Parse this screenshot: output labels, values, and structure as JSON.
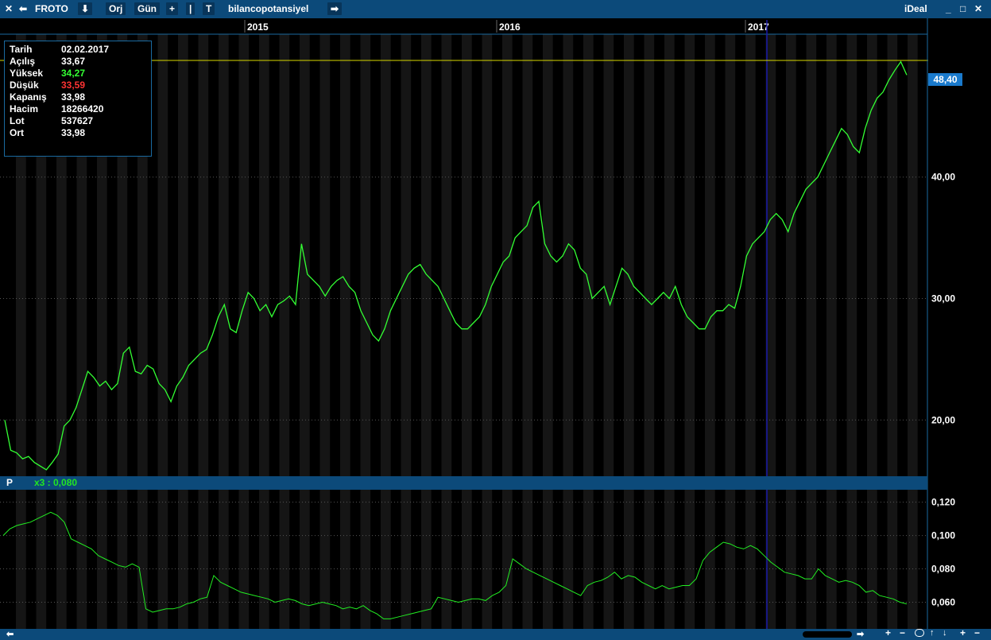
{
  "toolbar": {
    "close_glyph": "✕",
    "back_glyph": "⬅",
    "symbol": "FROTO",
    "down_glyph": "⬇",
    "orj_label": "Orj",
    "period_label": "Gün",
    "plus_label": "+",
    "bar_label": "|",
    "text_label": "T",
    "indicator_name": "bilancopotansiyel",
    "next_glyph": "➡",
    "brand": "iDeal",
    "minimize_glyph": "_",
    "maximize_glyph": "□",
    "close2_glyph": "✕"
  },
  "info": {
    "date_label": "Tarih",
    "date": "02.02.2017",
    "open_label": "Açılış",
    "open": "33,67",
    "high_label": "Yüksek",
    "high": "34,27",
    "low_label": "Düşük",
    "low": "33,59",
    "close_label": "Kapanış",
    "close": "33,98",
    "volume_label": "Hacim",
    "volume": "18266420",
    "lot_label": "Lot",
    "lot": "537627",
    "avg_label": "Ort",
    "avg": "33,98"
  },
  "panel": {
    "label": "P",
    "indicator": "x3 : 0,080"
  },
  "last_price": "48,40",
  "colors": {
    "price_line": "#33ff33",
    "indicator_line": "#22ee22",
    "accent": "#0c4a7a",
    "high": "#33ff33",
    "low": "#ff3333"
  },
  "chart_data": [
    {
      "type": "line",
      "x_tick_labels": [
        "2015",
        "2016",
        "2017"
      ],
      "y_tick_labels": [
        "20,00",
        "30,00",
        "40,00"
      ],
      "ylim": [
        15.5,
        51.5
      ],
      "series": [
        {
          "values": [
            20.0,
            17.5,
            17.3,
            16.8,
            17.0,
            16.5,
            16.2,
            15.9,
            16.5,
            17.2,
            19.5,
            20.0,
            21.0,
            22.5,
            24.0,
            23.5,
            22.8,
            23.2,
            22.5,
            23.0,
            25.5,
            26.0,
            24.0,
            23.8,
            24.5,
            24.2,
            23.0,
            22.5,
            21.5,
            22.8,
            23.5,
            24.5,
            25.0,
            25.5,
            25.8,
            27.0,
            28.5,
            29.5,
            27.5,
            27.2,
            29.0,
            30.5,
            30.0,
            29.0,
            29.5,
            28.5,
            29.5,
            29.8,
            30.2,
            29.5,
            34.5,
            32.0,
            31.5,
            31.0,
            30.2,
            31.0,
            31.5,
            31.8,
            31.0,
            30.5,
            29.0,
            28.0,
            27.0,
            26.5,
            27.5,
            29.0,
            30.0,
            31.0,
            32.0,
            32.5,
            32.8,
            32.0,
            31.5,
            31.0,
            30.0,
            29.0,
            28.0,
            27.5,
            27.5,
            28.0,
            28.5,
            29.5,
            31.0,
            32.0,
            33.0,
            33.5,
            35.0,
            35.5,
            36.0,
            37.5,
            38.0,
            34.5,
            33.5,
            33.0,
            33.5,
            34.5,
            34.0,
            32.5,
            32.0,
            30.0,
            30.5,
            31.0,
            29.5,
            31.0,
            32.5,
            32.0,
            31.0,
            30.5,
            30.0,
            29.5,
            30.0,
            30.5,
            30.0,
            31.0,
            29.5,
            28.5,
            28.0,
            27.5,
            27.5,
            28.5,
            29.0,
            29.0,
            29.5,
            29.2,
            31.0,
            33.5,
            34.5,
            35.0,
            35.5,
            36.5,
            37.0,
            36.5,
            35.5,
            37.0,
            38.0,
            39.0,
            39.5,
            40.0,
            41.0,
            42.0,
            43.0,
            44.0,
            43.5,
            42.5,
            42.0,
            44.0,
            45.5,
            46.5,
            47.0,
            48.0,
            48.8,
            49.5,
            48.4
          ]
        }
      ]
    },
    {
      "type": "line",
      "y_tick_labels": [
        "0,060",
        "0,080",
        "0,100",
        "0,120"
      ],
      "ylim": [
        0.044,
        0.127
      ],
      "series": [
        {
          "values": [
            0.1,
            0.104,
            0.106,
            0.107,
            0.108,
            0.11,
            0.112,
            0.114,
            0.112,
            0.108,
            0.098,
            0.096,
            0.094,
            0.092,
            0.088,
            0.086,
            0.084,
            0.082,
            0.081,
            0.083,
            0.081,
            0.056,
            0.054,
            0.055,
            0.056,
            0.056,
            0.057,
            0.059,
            0.06,
            0.062,
            0.063,
            0.076,
            0.072,
            0.07,
            0.068,
            0.066,
            0.065,
            0.064,
            0.063,
            0.062,
            0.06,
            0.061,
            0.062,
            0.061,
            0.059,
            0.058,
            0.059,
            0.06,
            0.059,
            0.058,
            0.056,
            0.057,
            0.056,
            0.058,
            0.055,
            0.053,
            0.05,
            0.05,
            0.051,
            0.052,
            0.053,
            0.054,
            0.055,
            0.056,
            0.063,
            0.062,
            0.061,
            0.06,
            0.061,
            0.062,
            0.062,
            0.061,
            0.064,
            0.066,
            0.07,
            0.086,
            0.083,
            0.08,
            0.078,
            0.076,
            0.074,
            0.072,
            0.07,
            0.068,
            0.066,
            0.064,
            0.07,
            0.072,
            0.073,
            0.075,
            0.078,
            0.074,
            0.076,
            0.075,
            0.072,
            0.07,
            0.068,
            0.07,
            0.068,
            0.069,
            0.07,
            0.07,
            0.074,
            0.085,
            0.09,
            0.093,
            0.096,
            0.095,
            0.093,
            0.092,
            0.094,
            0.092,
            0.088,
            0.084,
            0.081,
            0.078,
            0.077,
            0.076,
            0.074,
            0.074,
            0.08,
            0.076,
            0.074,
            0.072,
            0.073,
            0.072,
            0.07,
            0.066,
            0.067,
            0.064,
            0.063,
            0.062,
            0.06,
            0.059
          ]
        }
      ]
    }
  ]
}
